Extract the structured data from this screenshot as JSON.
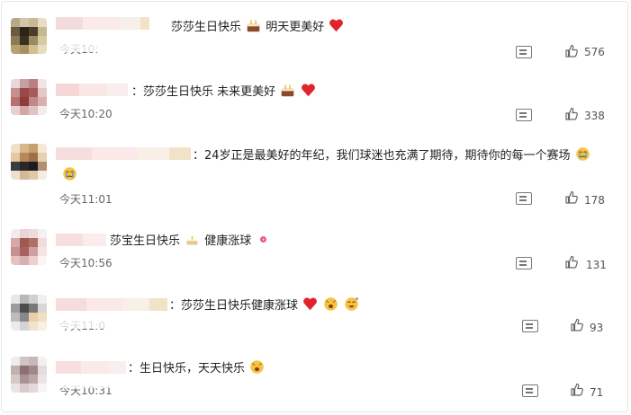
{
  "comments": [
    {
      "text": "莎莎生日快乐",
      "text2": "明天更美好",
      "time": "今天10:",
      "likes": "576"
    },
    {
      "text": "：莎莎生日快乐 未来更美好",
      "text2": "",
      "time": "今天10:20",
      "likes": "338"
    },
    {
      "text": "：24岁正是最美好的年纪，我们球迷也充满了期待，期待你的每一个赛场",
      "text2": "",
      "time": "今天11:01",
      "likes": "178"
    },
    {
      "text": "莎宝生日快乐",
      "text2": "健康涨球",
      "time": "今天10:56",
      "likes": "131"
    },
    {
      "text": "：莎莎生日快乐健康涨球",
      "text2": "",
      "time": "今天11:0",
      "likes": "93"
    },
    {
      "text": "：生日快乐，天天快乐",
      "text2": "",
      "time": "今天10:31",
      "likes": "71"
    }
  ],
  "icons": {
    "reply": "comment-icon",
    "like": "thumbs-up-icon",
    "cake": "cake-emoji",
    "heart": "red-heart-emoji"
  },
  "colors": {
    "heart": "#e0242b",
    "emoji_yellow": "#f6c343"
  }
}
